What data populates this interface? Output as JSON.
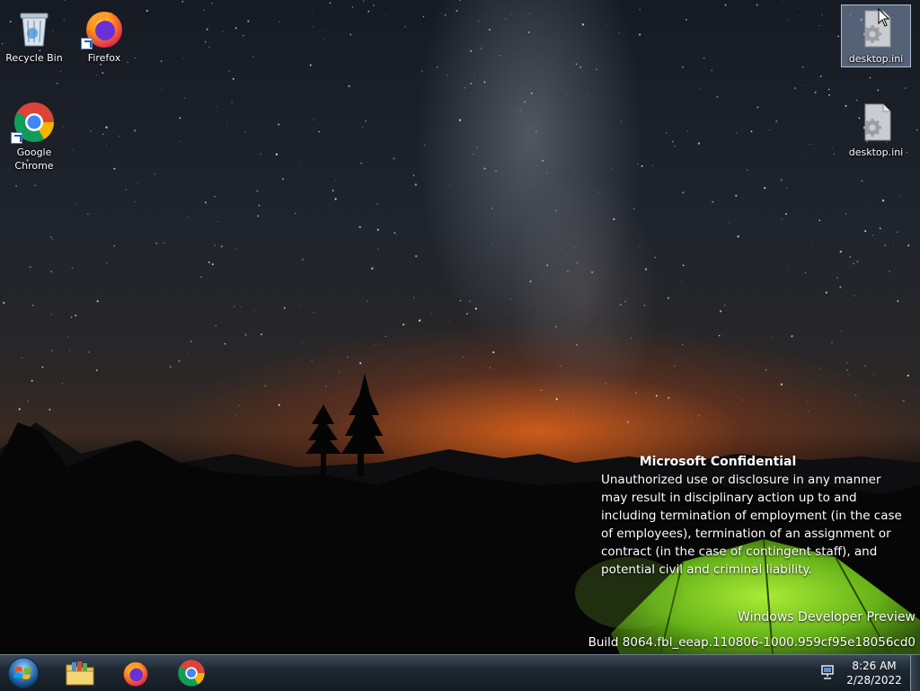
{
  "desktop": {
    "icons": [
      {
        "label": "Recycle Bin",
        "icon": "recycle-bin-icon"
      },
      {
        "label": "Firefox",
        "icon": "firefox-icon"
      },
      {
        "label": "Google Chrome",
        "icon": "chrome-icon"
      },
      {
        "label": "desktop.ini",
        "icon": "settings-file-icon",
        "selected": true
      },
      {
        "label": "desktop.ini",
        "icon": "settings-file-icon"
      }
    ],
    "watermark": {
      "title": "Microsoft Confidential",
      "body": "Unauthorized use or disclosure in any manner may result in disciplinary action up to and including termination of employment (in the case of employees), termination of an assignment or contract (in the case of contingent staff), and potential civil and criminal liability.",
      "edition": "Windows Developer Preview",
      "build": "Build 8064.fbl_eeap.110806-1000.959cf95e18056cd0"
    }
  },
  "taskbar": {
    "start": {
      "icon": "windows-start-orb-icon"
    },
    "pinned": [
      {
        "name": "file-explorer",
        "icon": "folder-library-icon"
      },
      {
        "name": "firefox",
        "icon": "firefox-icon"
      },
      {
        "name": "chrome",
        "icon": "chrome-icon"
      }
    ],
    "tray": {
      "network_icon": "network-icon"
    },
    "clock": {
      "time": "8:26 AM",
      "date": "2/28/2022"
    }
  }
}
